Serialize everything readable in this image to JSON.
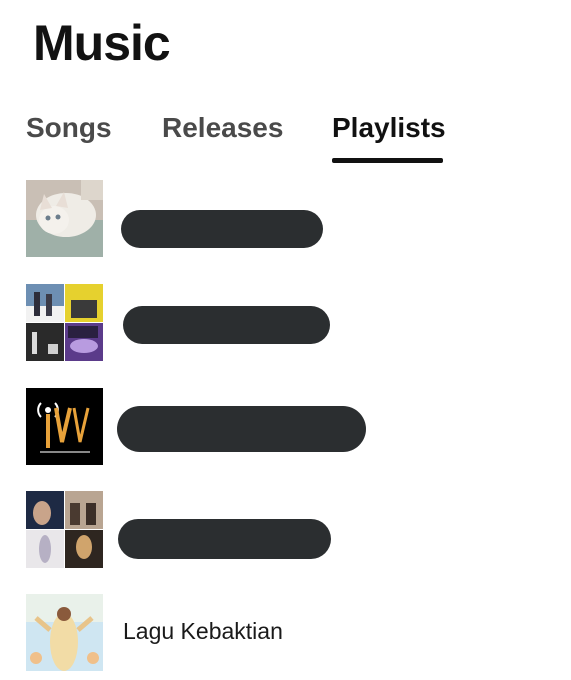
{
  "page": {
    "title": "Music"
  },
  "tabs": [
    {
      "label": "Songs",
      "active": false
    },
    {
      "label": "Releases",
      "active": false
    },
    {
      "label": "Playlists",
      "active": true
    }
  ],
  "playlists": [
    {
      "name": "",
      "redacted": true,
      "art": "cat-photo"
    },
    {
      "name": "",
      "redacted": true,
      "art": "album-collage"
    },
    {
      "name": "",
      "redacted": true,
      "art": "tv-logo"
    },
    {
      "name": "",
      "redacted": true,
      "art": "artist-collage"
    },
    {
      "name": "Lagu Kebaktian",
      "redacted": false,
      "art": "religious-painting"
    }
  ],
  "colors": {
    "redaction": "#2b2e30",
    "active_tab_underline": "#111111"
  }
}
